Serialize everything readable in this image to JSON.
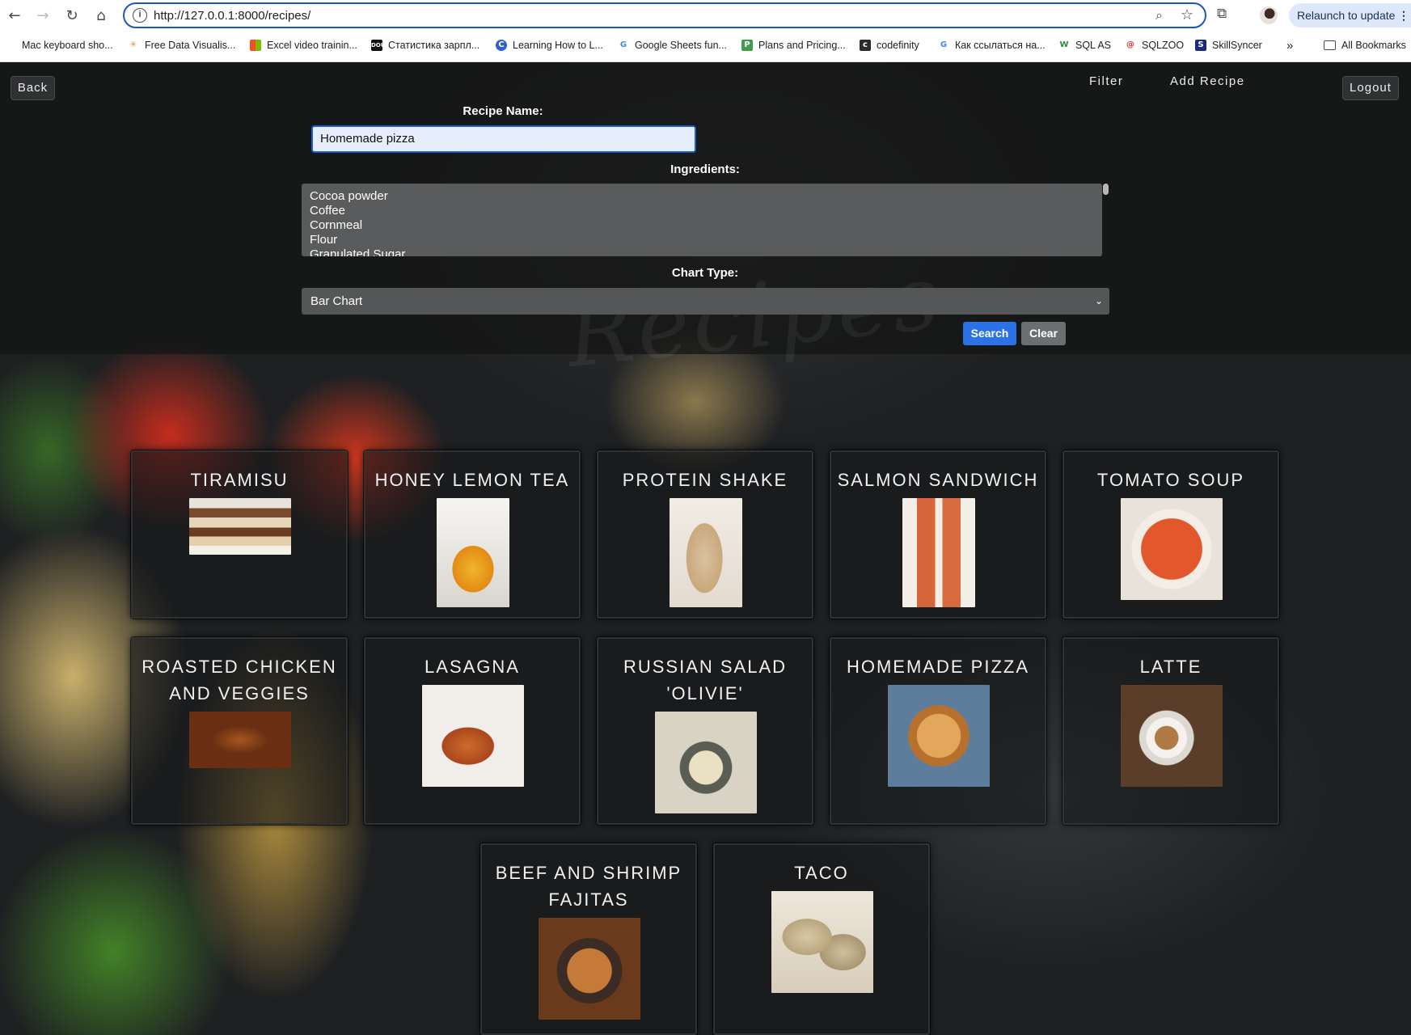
{
  "browser": {
    "url": "http://127.0.0.1:8000/recipes/",
    "relaunch_label": "Relaunch to update",
    "bookmarks": [
      "Mac keyboard sho...",
      "Free Data Visualis...",
      "Excel video trainin...",
      "Статистика зарпл...",
      "Learning How to L...",
      "Google Sheets fun...",
      "Plans and Pricing...",
      "codefinity",
      "Как ссылаться на...",
      "SQL AS",
      "SQLZOO",
      "SkillSyncer"
    ],
    "more_label": "»",
    "all_bookmarks_label": "All Bookmarks"
  },
  "nav": {
    "back": "Back",
    "filter": "Filter",
    "add_recipe": "Add Recipe",
    "logout": "Logout"
  },
  "form": {
    "recipe_name_label": "Recipe Name:",
    "recipe_name_value": "Homemade pizza",
    "ingredients_label": "Ingredients:",
    "ingredients": [
      "Cocoa powder",
      "Coffee",
      "Cornmeal",
      "Flour",
      "Granulated Sugar"
    ],
    "chart_type_label": "Chart Type:",
    "chart_type_value": "Bar Chart",
    "search_button": "Search",
    "clear_button": "Clear"
  },
  "recipes": [
    "Tiramisu",
    "Honey Lemon Tea",
    "Protein Shake",
    "Salmon Sandwich",
    "Tomato Soup",
    "Roasted Chicken and Veggies",
    "Lasagna",
    "Russian salad 'Olivie'",
    "Homemade Pizza",
    "Latte",
    "Beef and Shrimp Fajitas",
    "Taco"
  ]
}
